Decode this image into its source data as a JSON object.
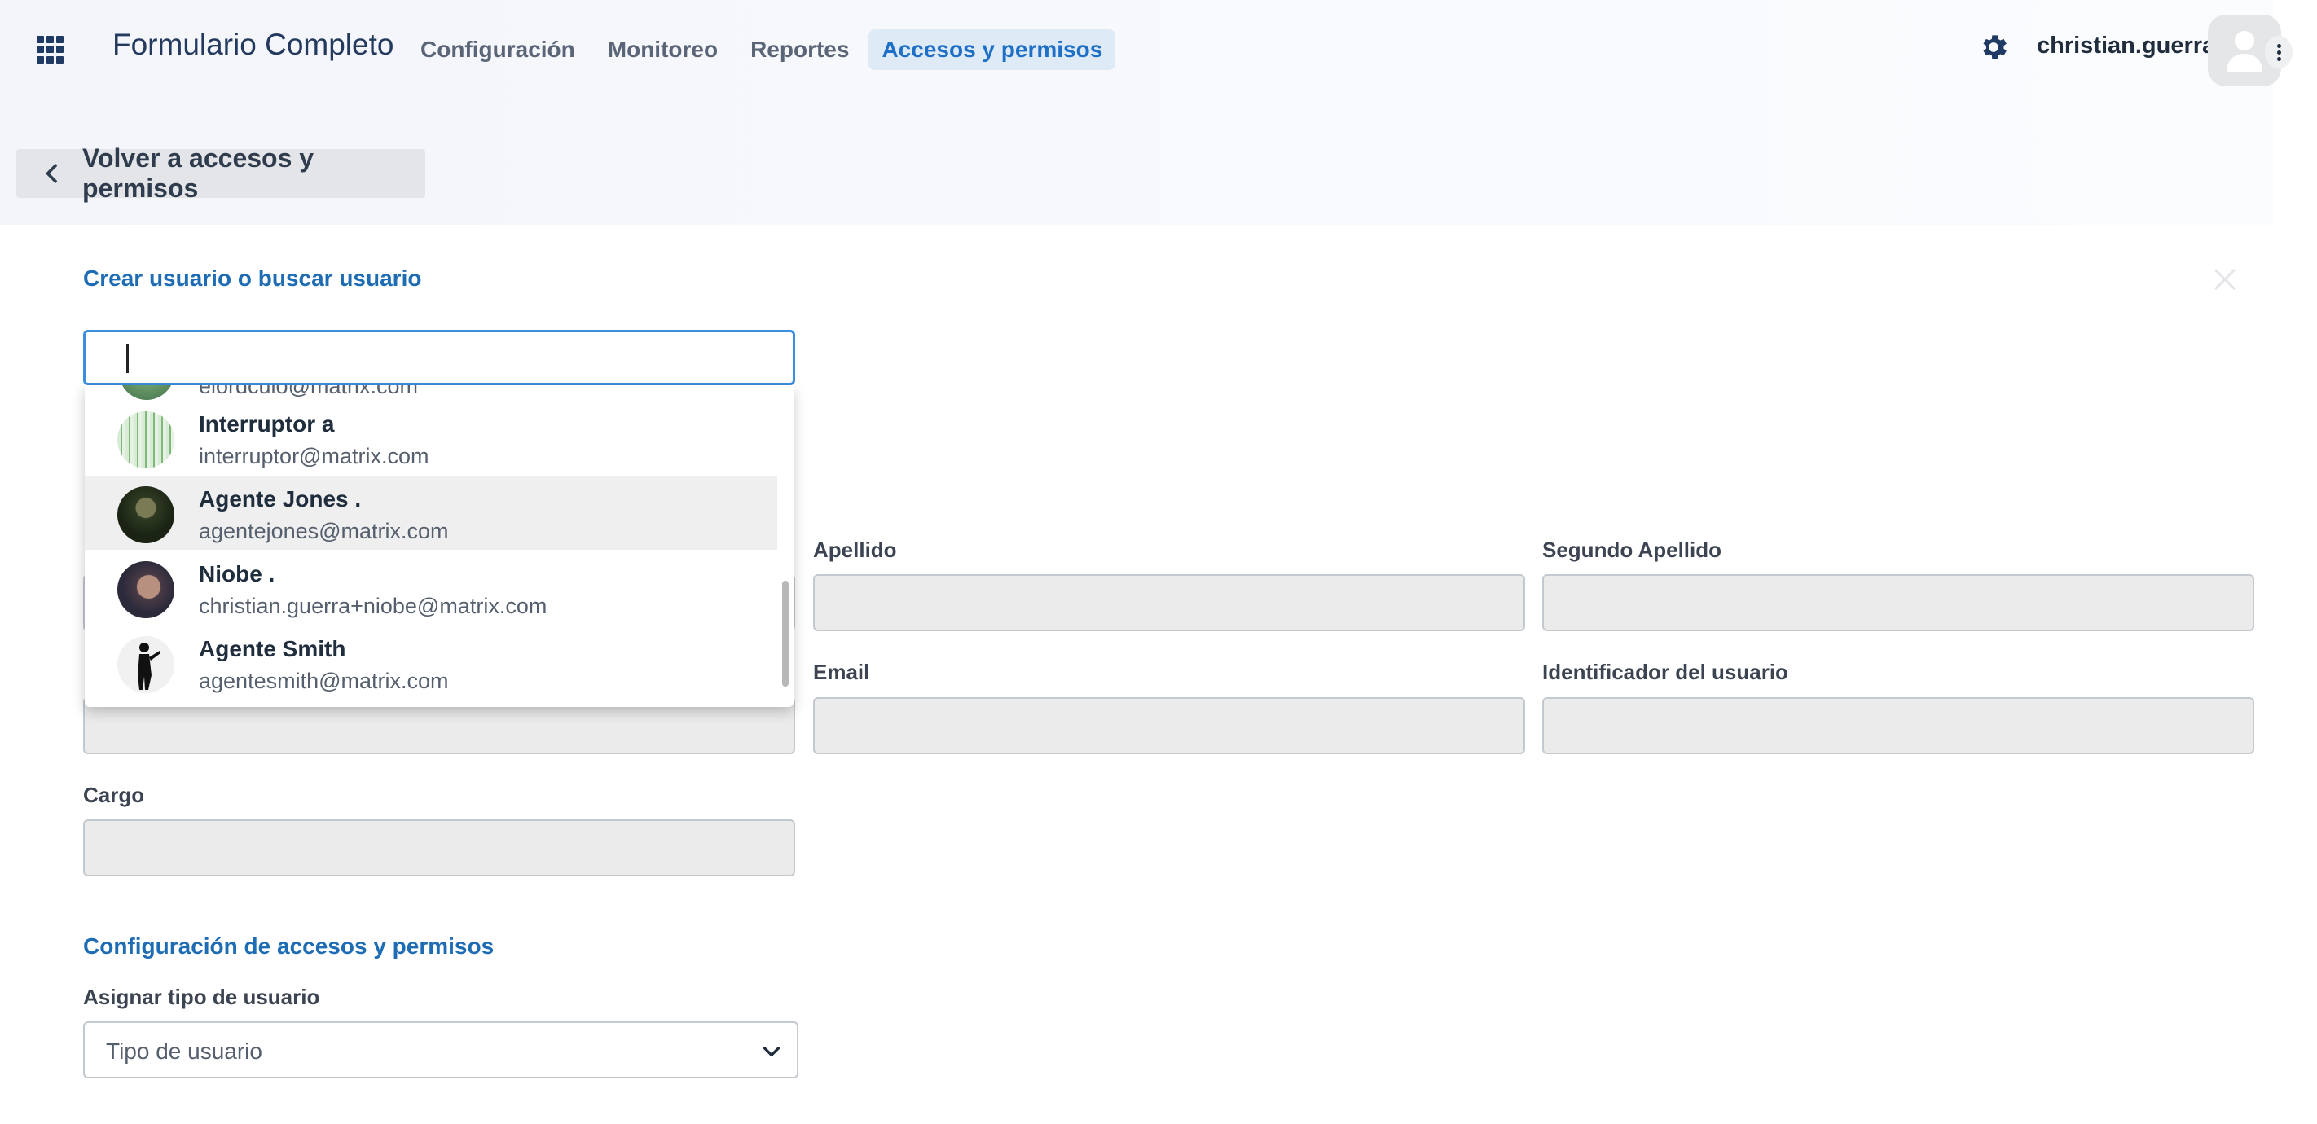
{
  "header": {
    "app_title": "Formulario Completo",
    "nav": [
      "Configuración",
      "Monitoreo",
      "Reportes",
      "Accesos y permisos"
    ],
    "active_nav": "Accesos y permisos",
    "username": "christian.guerra"
  },
  "back_button": {
    "label": "Volver a accesos y permisos"
  },
  "user_section": {
    "title": "Crear usuario o buscar usuario",
    "search_value": ""
  },
  "dropdown": {
    "partial_email": "elordculo@matrix.com",
    "items": [
      {
        "name": "Interruptor a",
        "email": "interruptor@matrix.com"
      },
      {
        "name": "Agente Jones .",
        "email": "agentejones@matrix.com"
      },
      {
        "name": "Niobe .",
        "email": "christian.guerra+niobe@matrix.com"
      },
      {
        "name": "Agente Smith",
        "email": "agentesmith@matrix.com"
      }
    ]
  },
  "form": {
    "apellido_label": "Apellido",
    "segundo_apellido_label": "Segundo Apellido",
    "email_label": "Email",
    "identificador_label": "Identificador del usuario",
    "cargo_label": "Cargo"
  },
  "access_section": {
    "title": "Configuración de accesos y permisos",
    "tipo_label": "Asignar tipo de usuario",
    "tipo_placeholder": "Tipo de usuario"
  },
  "colors": {
    "accent": "#1e6fc6",
    "section_title": "#1d6cb4",
    "input_focus": "#3b8ee0",
    "field_bg": "#ebebeb"
  }
}
